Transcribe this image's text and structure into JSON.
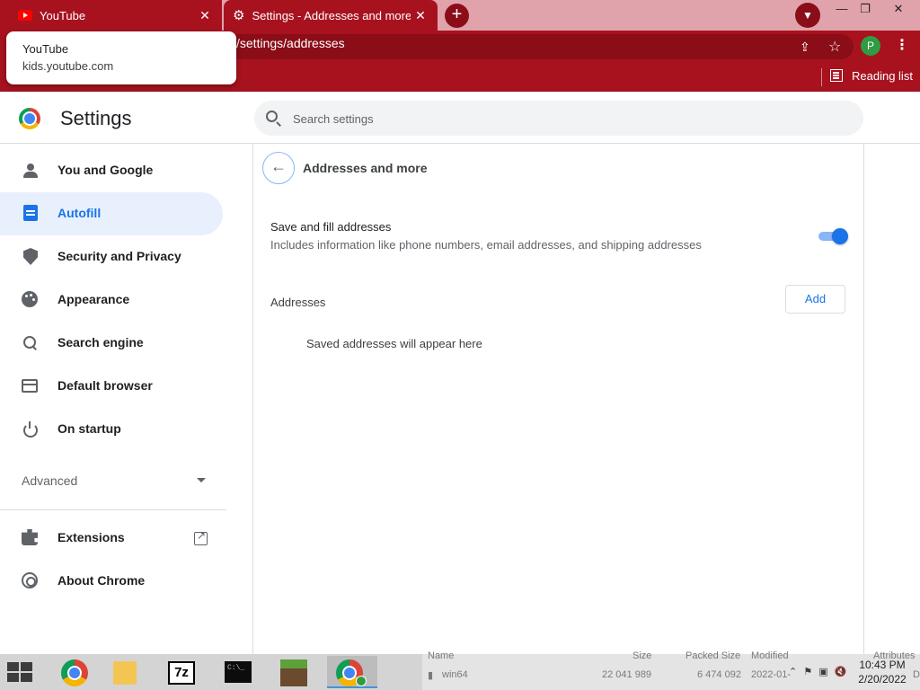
{
  "browser": {
    "tabs": [
      {
        "title": "YouTube",
        "icon": "youtube-icon",
        "close": "✕"
      },
      {
        "title": "Settings - Addresses and more",
        "icon": "gear-icon",
        "close": "✕"
      }
    ],
    "new_tab": "+",
    "url_prefix": "",
    "url_path": "/settings/addresses",
    "profile_initial": "P",
    "reading_list_label": "Reading list",
    "hover_card": {
      "title": "YouTube",
      "url": "kids.youtube.com"
    },
    "colors": {
      "frame": "#a8121f",
      "frame_dark": "#8a0d18",
      "accent": "#1a73e8"
    }
  },
  "settings": {
    "title": "Settings",
    "search_placeholder": "Search settings",
    "nav": [
      {
        "label": "You and Google",
        "icon": "person-icon"
      },
      {
        "label": "Autofill",
        "icon": "clipboard-icon",
        "active": true
      },
      {
        "label": "Security and Privacy",
        "icon": "shield-icon"
      },
      {
        "label": "Appearance",
        "icon": "palette-icon"
      },
      {
        "label": "Search engine",
        "icon": "search-icon"
      },
      {
        "label": "Default browser",
        "icon": "browser-icon"
      },
      {
        "label": "On startup",
        "icon": "power-icon"
      }
    ],
    "advanced_label": "Advanced",
    "extensions_label": "Extensions",
    "about_label": "About Chrome"
  },
  "page": {
    "title": "Addresses and more",
    "save_fill_title": "Save and fill addresses",
    "save_fill_desc": "Includes information like phone numbers, email addresses, and shipping addresses",
    "save_fill_enabled": true,
    "addresses_label": "Addresses",
    "add_button": "Add",
    "empty_message": "Saved addresses will appear here"
  },
  "taskbar": {
    "background_window": {
      "col_name": "Name",
      "col_size": "Size",
      "col_packed": "Packed Size",
      "col_modified": "Modified",
      "col_attributes": "Attributes",
      "row_name": "win64",
      "row_size": "22 041 989",
      "row_packed": "6 474 092",
      "row_modified": "2022-01-",
      "row_attr": "D"
    },
    "time": "10:43 PM",
    "date": "2/20/2022",
    "icon_7z": "7z",
    "cmd_text": "C:\\_"
  }
}
